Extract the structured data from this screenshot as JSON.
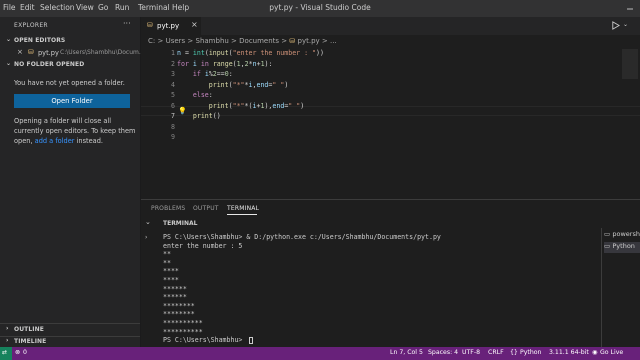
{
  "menu": [
    "File",
    "Edit",
    "Selection",
    "View",
    "Go",
    "Run",
    "Terminal",
    "Help"
  ],
  "window_title": "pyt.py - Visual Studio Code",
  "explorer": {
    "title": "EXPLORER",
    "more_label": "···",
    "open_editors": {
      "header": "OPEN EDITORS",
      "file_name": "pyt.py",
      "file_path": "C:\\Users\\Shambhu\\Docum..."
    },
    "no_folder": {
      "header": "NO FOLDER OPENED",
      "message": "You have not yet opened a folder.",
      "button": "Open Folder",
      "info_1": "Opening a folder will close all",
      "info_2": "currently open editors. To keep them",
      "info_3_pre": "open,",
      "info_link": "add a folder",
      "info_3_post": "instead."
    },
    "outline": "OUTLINE",
    "timeline": "TIMELINE"
  },
  "tab": {
    "name": "pyt.py",
    "close": "×"
  },
  "breadcrumb": [
    "C:",
    "Users",
    "Shambhu",
    "Documents",
    "pyt.py",
    "..."
  ],
  "code": {
    "line_numbers": [
      "1",
      "2",
      "3",
      "4",
      "5",
      "6",
      "7",
      "8",
      "9"
    ],
    "lines": [
      [
        [
          "v",
          "n"
        ],
        [
          "p",
          " = "
        ],
        [
          "b",
          "int"
        ],
        [
          "p",
          "("
        ],
        [
          "f",
          "input"
        ],
        [
          "p",
          "("
        ],
        [
          "s",
          "\"enter the number : \""
        ],
        [
          "p",
          "))"
        ]
      ],
      [
        [
          "k",
          "for"
        ],
        [
          "p",
          " "
        ],
        [
          "v",
          "i"
        ],
        [
          "p",
          " "
        ],
        [
          "k",
          "in"
        ],
        [
          "p",
          " "
        ],
        [
          "f",
          "range"
        ],
        [
          "p",
          "("
        ],
        [
          "n",
          "1"
        ],
        [
          "p",
          ","
        ],
        [
          "n",
          "2"
        ],
        [
          "p",
          "*"
        ],
        [
          "v",
          "n"
        ],
        [
          "p",
          "+"
        ],
        [
          "n",
          "1"
        ],
        [
          "p",
          "):"
        ]
      ],
      [
        [
          "p",
          "    "
        ],
        [
          "k",
          "if"
        ],
        [
          "p",
          " "
        ],
        [
          "v",
          "i"
        ],
        [
          "p",
          "%"
        ],
        [
          "n",
          "2"
        ],
        [
          "p",
          "=="
        ],
        [
          "n",
          "0"
        ],
        [
          "p",
          ":"
        ]
      ],
      [
        [
          "p",
          "        "
        ],
        [
          "f",
          "print"
        ],
        [
          "p",
          "("
        ],
        [
          "s",
          "\"*\""
        ],
        [
          "p",
          "*"
        ],
        [
          "v",
          "i"
        ],
        [
          "p",
          ","
        ],
        [
          "v",
          "end"
        ],
        [
          "p",
          "="
        ],
        [
          "s",
          "\" \""
        ],
        [
          "p",
          ")"
        ]
      ],
      [
        [
          "p",
          "    "
        ],
        [
          "k",
          "else"
        ],
        [
          "p",
          ":"
        ]
      ],
      [
        [
          "p",
          "        "
        ],
        [
          "f",
          "print"
        ],
        [
          "p",
          "("
        ],
        [
          "s",
          "\"*\""
        ],
        [
          "p",
          "*("
        ],
        [
          "v",
          "i"
        ],
        [
          "p",
          "+"
        ],
        [
          "n",
          "1"
        ],
        [
          "p",
          "),"
        ],
        [
          "v",
          "end"
        ],
        [
          "p",
          "="
        ],
        [
          "s",
          "\" \""
        ],
        [
          "p",
          ")"
        ]
      ],
      [
        [
          "p",
          "    "
        ],
        [
          "f",
          "print"
        ],
        [
          "p",
          "()"
        ]
      ],
      [],
      []
    ]
  },
  "panel": {
    "tabs": [
      "PROBLEMS",
      "OUTPUT",
      "TERMINAL"
    ],
    "active_tab": "TERMINAL",
    "section": "TERMINAL",
    "lines": [
      "PS C:\\Users\\Shambhu> & D:/python.exe c:/Users/Shambhu/Documents/pyt.py",
      "enter the number : 5",
      "**",
      "**",
      "****",
      "****",
      "******",
      "******",
      "********",
      "********",
      "**********",
      "**********",
      "PS C:\\Users\\Shambhu> "
    ],
    "terminals": [
      "powersh",
      "Python"
    ]
  },
  "status": {
    "errors": "0",
    "position": "Ln 7, Col 5",
    "spaces": "Spaces: 4",
    "encoding": "UTF-8",
    "eol": "CRLF",
    "language": "Python",
    "interpreter": "3.11.1 64-bit",
    "go_live": "Go Live"
  },
  "colors": {
    "statusbar": "#68217a",
    "accent_button": "#0e639c",
    "link": "#3794ff"
  }
}
